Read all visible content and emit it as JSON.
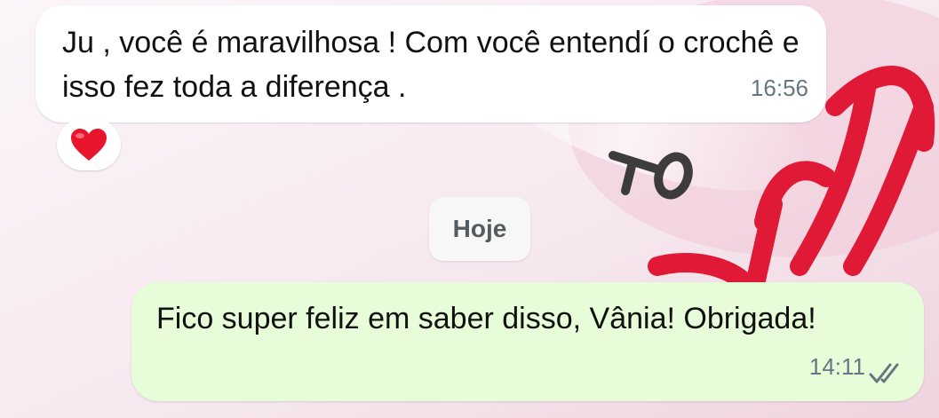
{
  "chat": {
    "incoming": {
      "text": "Ju , você é maravilhosa ! Com você entendí o crochê e isso fez toda a diferença .",
      "time": "16:56",
      "reaction": "heart-emoji"
    },
    "date_divider": "Hoje",
    "outgoing": {
      "text": "Fico super feliz em saber disso, Vânia! Obrigada!",
      "time": "14:11",
      "status": "delivered"
    }
  },
  "colors": {
    "incoming_bubble": "#ffffff",
    "outgoing_bubble": "#e7fcd8",
    "timestamp": "#667781",
    "heart": "#e8152c",
    "wallpaper_red": "#e01a36"
  }
}
